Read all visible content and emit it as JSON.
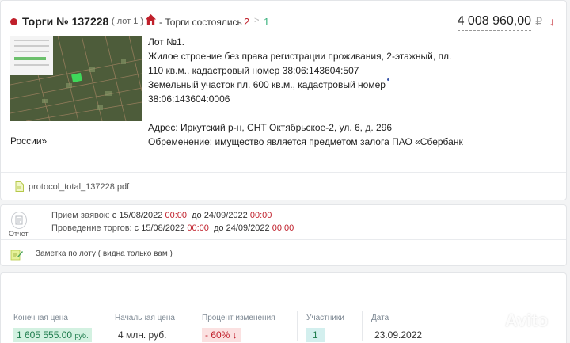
{
  "header": {
    "title": "Торги № 137228",
    "lot_badge": "( лот 1 )",
    "status": "- Торги состоялись",
    "count_a": "2",
    "count_sep": ">",
    "count_b": "1",
    "price": "4 008 960,00",
    "currency": "₽",
    "trend": "↓"
  },
  "description": {
    "line1": "Лот №1.",
    "line2": "Жилое строение без права регистрации проживания, 2-этажный, пл.",
    "line3": "110 кв.м., кадастровый номер 38:06:143604:507",
    "line4": "Земельный участок пл. 600 кв.м., кадастровый номер",
    "line5": "38:06:143604:0006",
    "line6": "Адрес: Иркутский р-н, СНТ Октябрьское-2, ул. 6, д. 296",
    "line7": "Обременение: имущество является предметом залога ПАО «Сбербанк",
    "line8": "России»"
  },
  "file": {
    "name": "protocol_total_137228.pdf"
  },
  "report": {
    "label": "Отчет"
  },
  "schedule": {
    "applications_label": "Прием заявок:",
    "applications_from": "с 15/08/2022",
    "applications_from_time": "00:00",
    "applications_to": "до 24/09/2022",
    "applications_to_time": "00:00",
    "auction_label": "Проведение торгов:",
    "auction_from": "с 15/08/2022",
    "auction_from_time": "00:00",
    "auction_to": "до 24/09/2022",
    "auction_to_time": "00:00"
  },
  "note": {
    "text": "Заметка по лоту ( видна только вам )"
  },
  "stats": {
    "final_price_label": "Конечная цена",
    "final_price": "1 605 555.00",
    "final_price_unit": "руб.",
    "start_price_label": "Начальная цена",
    "start_price": "4 млн. руб.",
    "change_label": "Процент изменения",
    "change": "- 60%",
    "change_arrow": "↓",
    "participants_label": "Участники",
    "participants": "1",
    "date_label": "Дата",
    "date": "23.09.2022"
  },
  "watermark": "Avito",
  "colors": {
    "accent_red": "#c0202b",
    "accent_green": "#3ab27d",
    "final_price_bg": "#d3f1e1",
    "change_bg": "#fbe1e1"
  }
}
